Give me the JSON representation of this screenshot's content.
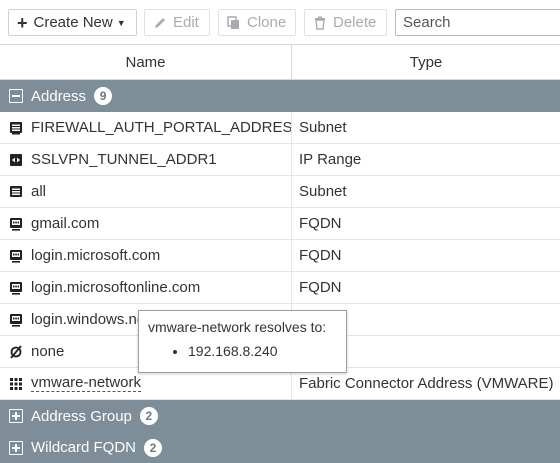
{
  "toolbar": {
    "create_new_label": "Create New",
    "edit_label": "Edit",
    "clone_label": "Clone",
    "delete_label": "Delete",
    "search_placeholder": "Search"
  },
  "table": {
    "columns": [
      "Name",
      "Type"
    ]
  },
  "groups": {
    "address": {
      "label": "Address",
      "count": "9"
    },
    "address_group": {
      "label": "Address Group",
      "count": "2"
    },
    "wildcard_fqdn": {
      "label": "Wildcard FQDN",
      "count": "2"
    }
  },
  "rows": [
    {
      "name": "FIREWALL_AUTH_PORTAL_ADDRESS",
      "type": "Subnet",
      "icon": "subnet-icon"
    },
    {
      "name": "SSLVPN_TUNNEL_ADDR1",
      "type": "IP Range",
      "icon": "ip-range-icon"
    },
    {
      "name": "all",
      "type": "Subnet",
      "icon": "subnet-icon"
    },
    {
      "name": "gmail.com",
      "type": "FQDN",
      "icon": "fqdn-icon"
    },
    {
      "name": "login.microsoft.com",
      "type": "FQDN",
      "icon": "fqdn-icon"
    },
    {
      "name": "login.microsoftonline.com",
      "type": "FQDN",
      "icon": "fqdn-icon"
    },
    {
      "name": "login.windows.net",
      "type": "",
      "icon": "fqdn-icon"
    },
    {
      "name": "none",
      "type": "",
      "icon": "none-icon"
    },
    {
      "name": "vmware-network",
      "type": "Fabric Connector Address (VMWARE)",
      "icon": "fabric-connector-icon"
    }
  ],
  "tooltip": {
    "title": "vmware-network resolves to:",
    "items": [
      "192.168.8.240"
    ]
  },
  "colors": {
    "group_header": "#7e8e98",
    "border": "#d6d8da"
  }
}
